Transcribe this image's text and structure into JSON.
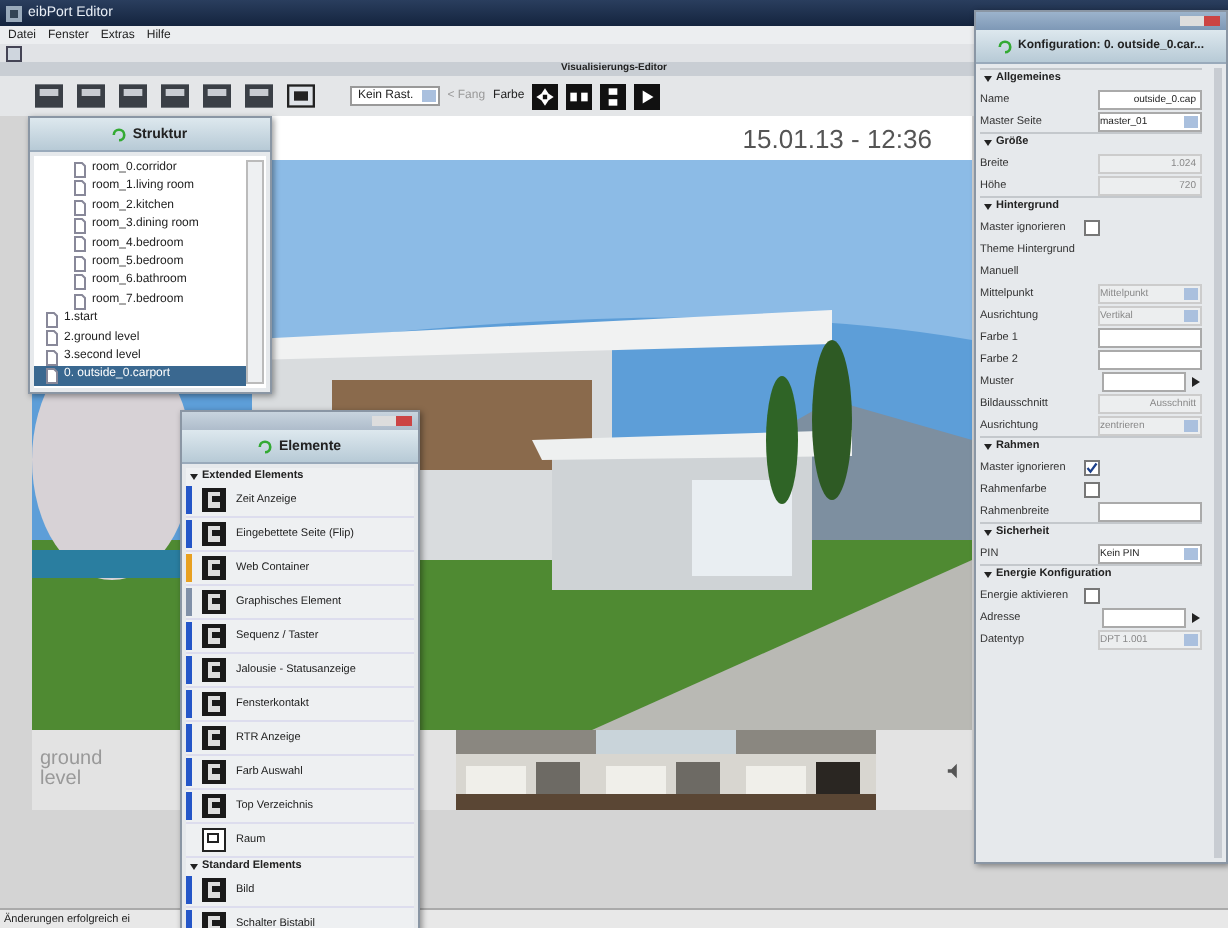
{
  "window": {
    "title": "eibPort Editor"
  },
  "menu": [
    "Datei",
    "Fenster",
    "Extras",
    "Hilfe"
  ],
  "editor": {
    "title": "Visualisierungs-Editor",
    "raster": "Kein Rast.",
    "snap": "< Fang",
    "color_label": "Farbe",
    "timestamp": "15.01.13 - 12:36",
    "level_label": "ground level"
  },
  "structure": {
    "title": "Struktur",
    "nested_items": [
      {
        "label": "room_0.corridor",
        "selected": false
      },
      {
        "label": "room_1.living room",
        "selected": false
      },
      {
        "label": "room_2.kitchen",
        "selected": false
      },
      {
        "label": "room_3.dining room",
        "selected": false
      },
      {
        "label": "room_4.bedroom",
        "selected": false
      },
      {
        "label": "room_5.bedroom",
        "selected": false
      },
      {
        "label": "room_6.bathroom",
        "selected": false
      },
      {
        "label": "room_7.bedroom",
        "selected": false
      }
    ],
    "items": [
      {
        "label": "1.start",
        "selected": false
      },
      {
        "label": "2.ground level",
        "selected": false
      },
      {
        "label": "3.second level",
        "selected": false
      },
      {
        "label": "0. outside_0.carport",
        "selected": true
      }
    ]
  },
  "elements": {
    "title": "Elemente",
    "sections": [
      {
        "title": "Extended Elements",
        "expanded": true,
        "items": [
          {
            "label": "Zeit Anzeige",
            "color": "#2456c8"
          },
          {
            "label": "Eingebettete Seite (Flip)",
            "color": "#2456c8"
          },
          {
            "label": "Web Container",
            "color": "#e8a020"
          },
          {
            "label": "Graphisches Element",
            "color": "#8090a8"
          },
          {
            "label": "Sequenz / Taster",
            "color": "#2456c8"
          },
          {
            "label": "Jalousie - Statusanzeige",
            "color": "#2456c8"
          },
          {
            "label": "Fensterkontakt",
            "color": "#2456c8"
          },
          {
            "label": "RTR Anzeige",
            "color": "#2456c8"
          },
          {
            "label": "Farb Auswahl",
            "color": "#2456c8"
          },
          {
            "label": "Top Verzeichnis",
            "color": "#2456c8"
          },
          {
            "label": "Raum"
          }
        ]
      },
      {
        "title": "Standard Elements",
        "expanded": true,
        "items": [
          {
            "label": "Bild",
            "color": "#2456c8"
          },
          {
            "label": "Schalter Bistabil",
            "color": "#2456c8"
          }
        ]
      }
    ]
  },
  "config": {
    "title": "Konfiguration: 0. outside_0.car...",
    "sections": [
      {
        "title": "Allgemeines",
        "rows": [
          {
            "kind": "text",
            "label": "Name",
            "value": "outside_0.cap"
          },
          {
            "kind": "select",
            "label": "Master Seite",
            "value": "master_01"
          }
        ]
      },
      {
        "title": "Größe",
        "rows": [
          {
            "kind": "text",
            "label": "Breite",
            "value": "1.024",
            "disabled": true
          },
          {
            "kind": "text",
            "label": "Höhe",
            "value": "720",
            "disabled": true
          }
        ]
      },
      {
        "title": "Hintergrund",
        "rows": [
          {
            "kind": "check",
            "label": "Master ignorieren",
            "checked": false
          },
          {
            "kind": "plain",
            "label": "Theme Hintergrund"
          },
          {
            "kind": "plain",
            "label": "Manuell"
          },
          {
            "kind": "select",
            "label": "Mittelpunkt",
            "value": "Mittelpunkt",
            "disabled": true
          },
          {
            "kind": "select",
            "label": "Ausrichtung",
            "value": "Vertikal",
            "disabled": true
          },
          {
            "kind": "empty",
            "label": "Farbe 1"
          },
          {
            "kind": "empty",
            "label": "Farbe 2"
          },
          {
            "kind": "picker",
            "label": "Muster"
          },
          {
            "kind": "text",
            "label": "Bildausschnitt",
            "value": "Ausschnitt",
            "disabled": true
          },
          {
            "kind": "select",
            "label": "Ausrichtung",
            "value": "zentrieren",
            "disabled": true
          }
        ]
      },
      {
        "title": "Rahmen",
        "rows": [
          {
            "kind": "check",
            "label": "Master ignorieren",
            "checked": true
          },
          {
            "kind": "check",
            "label": "Rahmenfarbe",
            "checked": false
          },
          {
            "kind": "empty",
            "label": "Rahmenbreite"
          }
        ]
      },
      {
        "title": "Sicherheit",
        "rows": [
          {
            "kind": "select",
            "label": "PIN",
            "value": "Kein PIN"
          }
        ]
      },
      {
        "title": "Energie Konfiguration",
        "rows": [
          {
            "kind": "check",
            "label": "Energie aktivieren",
            "checked": false
          },
          {
            "kind": "picker",
            "label": "Adresse"
          },
          {
            "kind": "select",
            "label": "Datentyp",
            "value": "DPT 1.001",
            "disabled": true
          }
        ]
      }
    ]
  },
  "status_bar": {
    "text": "Änderungen erfolgreich ei"
  }
}
